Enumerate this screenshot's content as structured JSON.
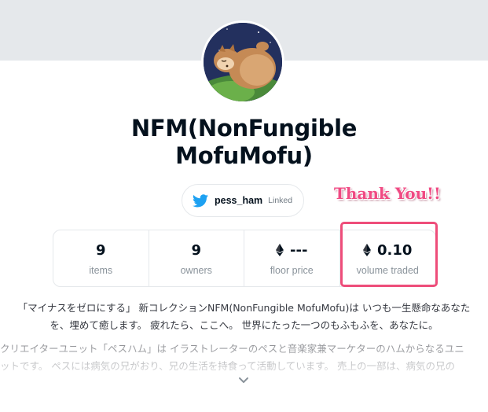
{
  "collection": {
    "title_line1": "NFM(NonFungible",
    "title_line2": "MofuMofu)"
  },
  "social": {
    "icon": "twitter-icon",
    "handle": "pess_ham",
    "status": "Linked"
  },
  "stats": [
    {
      "value": "9",
      "label": "items",
      "icon": ""
    },
    {
      "value": "9",
      "label": "owners",
      "icon": ""
    },
    {
      "value": "---",
      "label": "floor price",
      "icon": "eth-icon"
    },
    {
      "value": "0.10",
      "label": "volume traded",
      "icon": "eth-icon"
    }
  ],
  "annotation": {
    "text": "Thank You!!",
    "color": "#ee4d7a"
  },
  "description": {
    "line1": "「マイナスをゼロにする」 新コレクションNFM(NonFungible MofuMofu)は いつも一生懸命なあなた",
    "line2": "を、埋めて癒します。 疲れたら、ここへ。 世界にたった一つのもふもふを、あなたに。",
    "line3": "クリエイターユニット「ペスハム」は イラストレーターのペスと音楽家兼マーケターのハムからなるユニ",
    "line4": "ットです。 ペスには病気の兄がおり、兄の生活を持食って活動しています。 売上の一部は、病気の兄の"
  },
  "colors": {
    "banner": "#e5e8eb",
    "twitter": "#1da1f2",
    "highlight": "#ee4d7a"
  }
}
